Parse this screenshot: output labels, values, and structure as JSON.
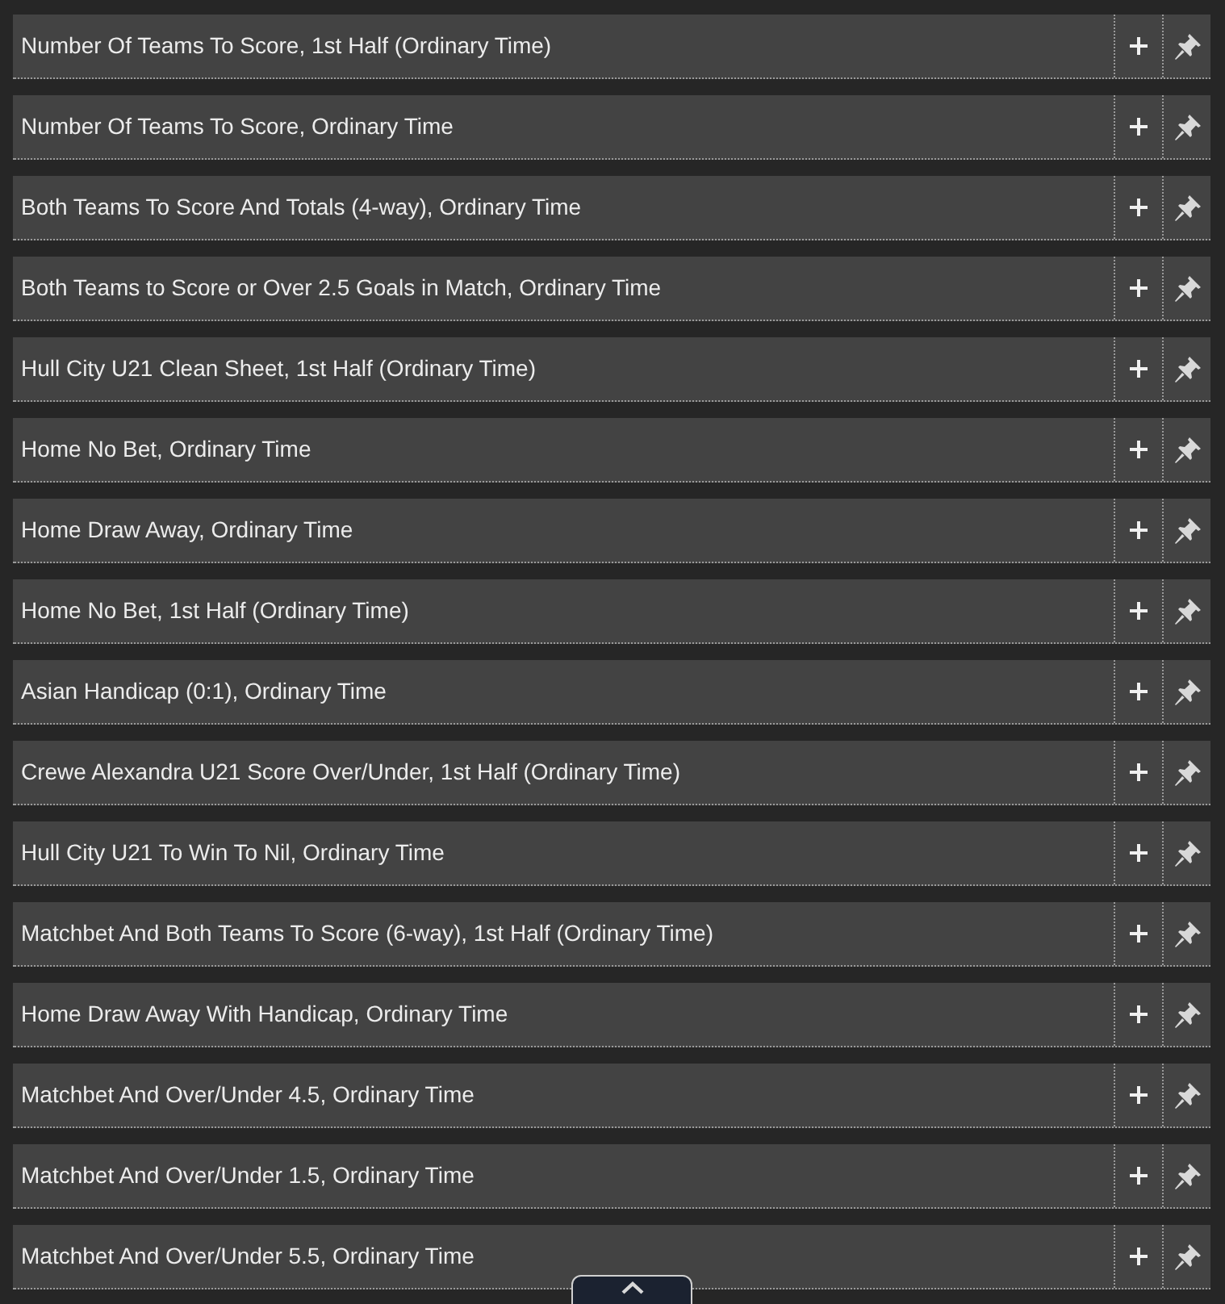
{
  "markets": [
    {
      "title": "Number Of Teams To Score, 1st Half (Ordinary Time)"
    },
    {
      "title": "Number Of Teams To Score, Ordinary Time"
    },
    {
      "title": "Both Teams To Score And Totals (4-way), Ordinary Time"
    },
    {
      "title": "Both Teams to Score or Over 2.5 Goals in Match, Ordinary Time"
    },
    {
      "title": "Hull City U21 Clean Sheet, 1st Half (Ordinary Time)"
    },
    {
      "title": "Home No Bet, Ordinary Time"
    },
    {
      "title": "Home Draw Away, Ordinary Time"
    },
    {
      "title": "Home No Bet, 1st Half (Ordinary Time)"
    },
    {
      "title": "Asian Handicap (0:1), Ordinary Time"
    },
    {
      "title": "Crewe Alexandra U21 Score Over/Under, 1st Half (Ordinary Time)"
    },
    {
      "title": "Hull City U21 To Win To Nil, Ordinary Time"
    },
    {
      "title": "Matchbet And Both Teams To Score (6-way), 1st Half (Ordinary Time)"
    },
    {
      "title": "Home Draw Away With Handicap, Ordinary Time"
    },
    {
      "title": "Matchbet And Over/Under 4.5, Ordinary Time"
    },
    {
      "title": "Matchbet And Over/Under 1.5, Ordinary Time"
    },
    {
      "title": "Matchbet And Over/Under 5.5, Ordinary Time"
    }
  ]
}
